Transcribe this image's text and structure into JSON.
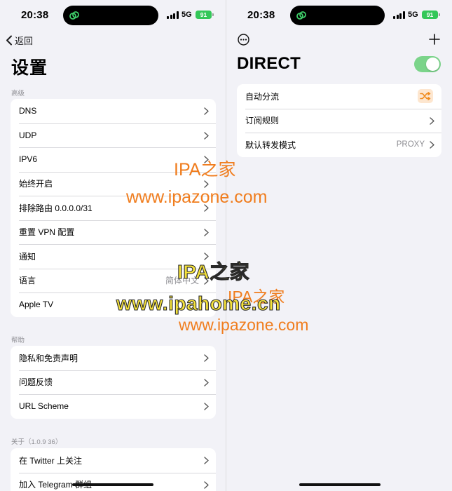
{
  "status_bar": {
    "time": "20:38",
    "network": "5G",
    "battery": "91"
  },
  "left": {
    "back_label": "返回",
    "title": "设置",
    "sections": [
      {
        "label": "高级",
        "rows": [
          {
            "label": "DNS"
          },
          {
            "label": "UDP"
          },
          {
            "label": "IPV6"
          },
          {
            "label": "始终开启"
          },
          {
            "label": "排除路由 0.0.0.0/31"
          },
          {
            "label": "重置 VPN 配置"
          },
          {
            "label": "通知"
          },
          {
            "label": "语言",
            "value": "简体中文"
          },
          {
            "label": "Apple TV"
          }
        ]
      },
      {
        "label": "帮助",
        "rows": [
          {
            "label": "隐私和免责声明"
          },
          {
            "label": "问题反馈"
          },
          {
            "label": "URL Scheme"
          }
        ]
      },
      {
        "label": "关于（1.0.9 36）",
        "rows": [
          {
            "label": "在 Twitter 上关注"
          },
          {
            "label": "加入 Telegram 群组"
          }
        ]
      }
    ]
  },
  "right": {
    "title": "DIRECT",
    "toggle_on": true,
    "rows": [
      {
        "label": "自动分流",
        "icon": "shuffle-icon"
      },
      {
        "label": "订阅规则"
      },
      {
        "label": "默认转发模式",
        "value": "PROXY"
      }
    ]
  },
  "watermarks": {
    "ipazone_cn_1": "IPA之家",
    "ipazone_url_1": "www.ipazone.com",
    "ipahome_cn": "IPA之家",
    "ipahome_url": "www.ipahome.cn",
    "ipazone_cn_2": "IPA之家",
    "ipazone_url_2": "www.ipazone.com"
  },
  "colors": {
    "accent_green": "#34c759",
    "toggle_green": "#7bd48a",
    "shuffle_orange": "#f08a1c",
    "watermark_orange": "#f07d1e",
    "watermark_yellow": "#f6e33b"
  }
}
